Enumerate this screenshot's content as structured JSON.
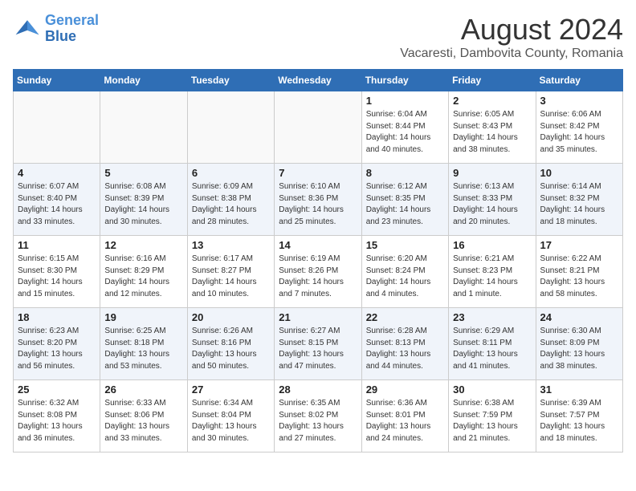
{
  "header": {
    "logo_line1": "General",
    "logo_line2": "Blue",
    "month_year": "August 2024",
    "location": "Vacaresti, Dambovita County, Romania"
  },
  "days_of_week": [
    "Sunday",
    "Monday",
    "Tuesday",
    "Wednesday",
    "Thursday",
    "Friday",
    "Saturday"
  ],
  "weeks": [
    [
      {
        "day": "",
        "info": "",
        "empty": true
      },
      {
        "day": "",
        "info": "",
        "empty": true
      },
      {
        "day": "",
        "info": "",
        "empty": true
      },
      {
        "day": "",
        "info": "",
        "empty": true
      },
      {
        "day": "1",
        "info": "Sunrise: 6:04 AM\nSunset: 8:44 PM\nDaylight: 14 hours\nand 40 minutes."
      },
      {
        "day": "2",
        "info": "Sunrise: 6:05 AM\nSunset: 8:43 PM\nDaylight: 14 hours\nand 38 minutes."
      },
      {
        "day": "3",
        "info": "Sunrise: 6:06 AM\nSunset: 8:42 PM\nDaylight: 14 hours\nand 35 minutes."
      }
    ],
    [
      {
        "day": "4",
        "info": "Sunrise: 6:07 AM\nSunset: 8:40 PM\nDaylight: 14 hours\nand 33 minutes."
      },
      {
        "day": "5",
        "info": "Sunrise: 6:08 AM\nSunset: 8:39 PM\nDaylight: 14 hours\nand 30 minutes."
      },
      {
        "day": "6",
        "info": "Sunrise: 6:09 AM\nSunset: 8:38 PM\nDaylight: 14 hours\nand 28 minutes."
      },
      {
        "day": "7",
        "info": "Sunrise: 6:10 AM\nSunset: 8:36 PM\nDaylight: 14 hours\nand 25 minutes."
      },
      {
        "day": "8",
        "info": "Sunrise: 6:12 AM\nSunset: 8:35 PM\nDaylight: 14 hours\nand 23 minutes."
      },
      {
        "day": "9",
        "info": "Sunrise: 6:13 AM\nSunset: 8:33 PM\nDaylight: 14 hours\nand 20 minutes."
      },
      {
        "day": "10",
        "info": "Sunrise: 6:14 AM\nSunset: 8:32 PM\nDaylight: 14 hours\nand 18 minutes."
      }
    ],
    [
      {
        "day": "11",
        "info": "Sunrise: 6:15 AM\nSunset: 8:30 PM\nDaylight: 14 hours\nand 15 minutes."
      },
      {
        "day": "12",
        "info": "Sunrise: 6:16 AM\nSunset: 8:29 PM\nDaylight: 14 hours\nand 12 minutes."
      },
      {
        "day": "13",
        "info": "Sunrise: 6:17 AM\nSunset: 8:27 PM\nDaylight: 14 hours\nand 10 minutes."
      },
      {
        "day": "14",
        "info": "Sunrise: 6:19 AM\nSunset: 8:26 PM\nDaylight: 14 hours\nand 7 minutes."
      },
      {
        "day": "15",
        "info": "Sunrise: 6:20 AM\nSunset: 8:24 PM\nDaylight: 14 hours\nand 4 minutes."
      },
      {
        "day": "16",
        "info": "Sunrise: 6:21 AM\nSunset: 8:23 PM\nDaylight: 14 hours\nand 1 minute."
      },
      {
        "day": "17",
        "info": "Sunrise: 6:22 AM\nSunset: 8:21 PM\nDaylight: 13 hours\nand 58 minutes."
      }
    ],
    [
      {
        "day": "18",
        "info": "Sunrise: 6:23 AM\nSunset: 8:20 PM\nDaylight: 13 hours\nand 56 minutes."
      },
      {
        "day": "19",
        "info": "Sunrise: 6:25 AM\nSunset: 8:18 PM\nDaylight: 13 hours\nand 53 minutes."
      },
      {
        "day": "20",
        "info": "Sunrise: 6:26 AM\nSunset: 8:16 PM\nDaylight: 13 hours\nand 50 minutes."
      },
      {
        "day": "21",
        "info": "Sunrise: 6:27 AM\nSunset: 8:15 PM\nDaylight: 13 hours\nand 47 minutes."
      },
      {
        "day": "22",
        "info": "Sunrise: 6:28 AM\nSunset: 8:13 PM\nDaylight: 13 hours\nand 44 minutes."
      },
      {
        "day": "23",
        "info": "Sunrise: 6:29 AM\nSunset: 8:11 PM\nDaylight: 13 hours\nand 41 minutes."
      },
      {
        "day": "24",
        "info": "Sunrise: 6:30 AM\nSunset: 8:09 PM\nDaylight: 13 hours\nand 38 minutes."
      }
    ],
    [
      {
        "day": "25",
        "info": "Sunrise: 6:32 AM\nSunset: 8:08 PM\nDaylight: 13 hours\nand 36 minutes."
      },
      {
        "day": "26",
        "info": "Sunrise: 6:33 AM\nSunset: 8:06 PM\nDaylight: 13 hours\nand 33 minutes."
      },
      {
        "day": "27",
        "info": "Sunrise: 6:34 AM\nSunset: 8:04 PM\nDaylight: 13 hours\nand 30 minutes."
      },
      {
        "day": "28",
        "info": "Sunrise: 6:35 AM\nSunset: 8:02 PM\nDaylight: 13 hours\nand 27 minutes."
      },
      {
        "day": "29",
        "info": "Sunrise: 6:36 AM\nSunset: 8:01 PM\nDaylight: 13 hours\nand 24 minutes."
      },
      {
        "day": "30",
        "info": "Sunrise: 6:38 AM\nSunset: 7:59 PM\nDaylight: 13 hours\nand 21 minutes."
      },
      {
        "day": "31",
        "info": "Sunrise: 6:39 AM\nSunset: 7:57 PM\nDaylight: 13 hours\nand 18 minutes."
      }
    ]
  ]
}
